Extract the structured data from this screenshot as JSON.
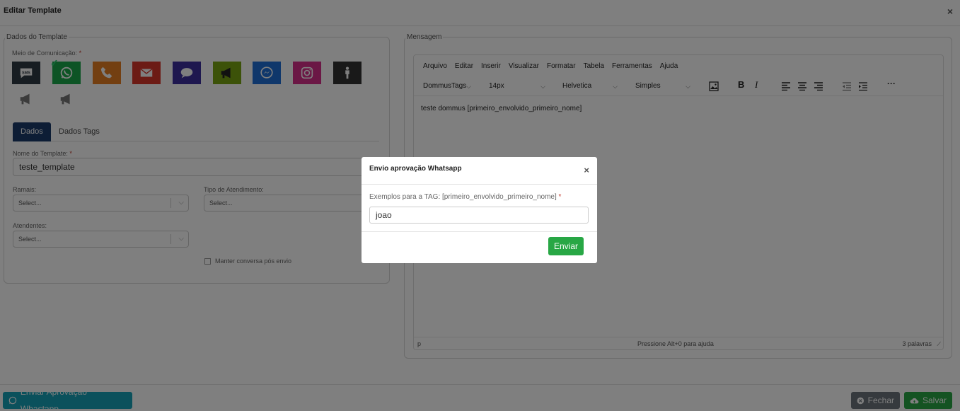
{
  "window": {
    "title": "Editar Template",
    "close_glyph": "×"
  },
  "left_panel": {
    "legend": "Dados do Template",
    "channel_label": "Meio de Comunicação:",
    "required_mark": "*",
    "channels": [
      {
        "name": "sms",
        "color": "#2f3a44",
        "icon": "sms-icon",
        "badge_text": "SMS"
      },
      {
        "name": "whatsapp",
        "color": "#1aa94b",
        "icon": "whatsapp-icon",
        "selected": true
      },
      {
        "name": "phone",
        "color": "#e67e22",
        "icon": "phone-icon"
      },
      {
        "name": "email",
        "color": "#d9362b",
        "icon": "envelope-icon"
      },
      {
        "name": "chat",
        "color": "#3d2f9e",
        "icon": "chat-bubble-icon"
      },
      {
        "name": "campaign",
        "color": "#79a412",
        "icon": "megaphone-icon"
      },
      {
        "name": "messenger",
        "color": "#1f6fd6",
        "icon": "messenger-icon"
      },
      {
        "name": "instagram",
        "color": "#d62e8b",
        "icon": "instagram-icon"
      },
      {
        "name": "person",
        "color": "#333333",
        "icon": "person-icon"
      },
      {
        "name": "campaign-2",
        "color": "#777777",
        "icon": "megaphone-icon"
      },
      {
        "name": "campaign-3",
        "color": "#777777",
        "icon": "megaphone-icon"
      }
    ],
    "tabs": [
      {
        "label": "Dados",
        "active": true
      },
      {
        "label": "Dados Tags",
        "active": false
      }
    ],
    "template_name_label": "Nome do Template:",
    "template_name_value": "teste_template",
    "ramais_label": "Ramais:",
    "ramais_value": "Select...",
    "tipo_label": "Tipo de Atendimento:",
    "tipo_value": "Select...",
    "atendentes_label": "Atendentes:",
    "atendentes_value": "Select...",
    "manter_label": "Manter conversa pós envio"
  },
  "right_panel": {
    "legend": "Mensagem",
    "menu": [
      "Arquivo",
      "Editar",
      "Inserir",
      "Visualizar",
      "Formatar",
      "Tabela",
      "Ferramentas",
      "Ajuda"
    ],
    "toolbar": {
      "tags_dropdown": "DommusTags",
      "size_dropdown": "14px",
      "font_dropdown": "Helvetica",
      "style_dropdown": "Simples",
      "bold": "B",
      "italic": "I",
      "more": "···"
    },
    "content_text": "teste dommus [primeiro_envolvido_primeiro_nome]",
    "status_path": "p",
    "status_help": "Pressione Alt+0 para ajuda",
    "status_words": "3 palavras"
  },
  "footer": {
    "send_approval_label": "Enviar Aprovação Whastapp",
    "close_label": "Fechar",
    "save_label": "Salvar"
  },
  "modal": {
    "title": "Envio aprovação Whatsapp",
    "close_glyph": "×",
    "field_label": "Exemplos para a TAG: [primeiro_envolvido_primeiro_nome]",
    "field_required": "*",
    "field_value": "joao",
    "send_label": "Enviar"
  },
  "colors": {
    "accent_navy": "#1b3a6b",
    "teal": "#17a2b8",
    "green": "#28a745",
    "gray": "#6c757d"
  }
}
